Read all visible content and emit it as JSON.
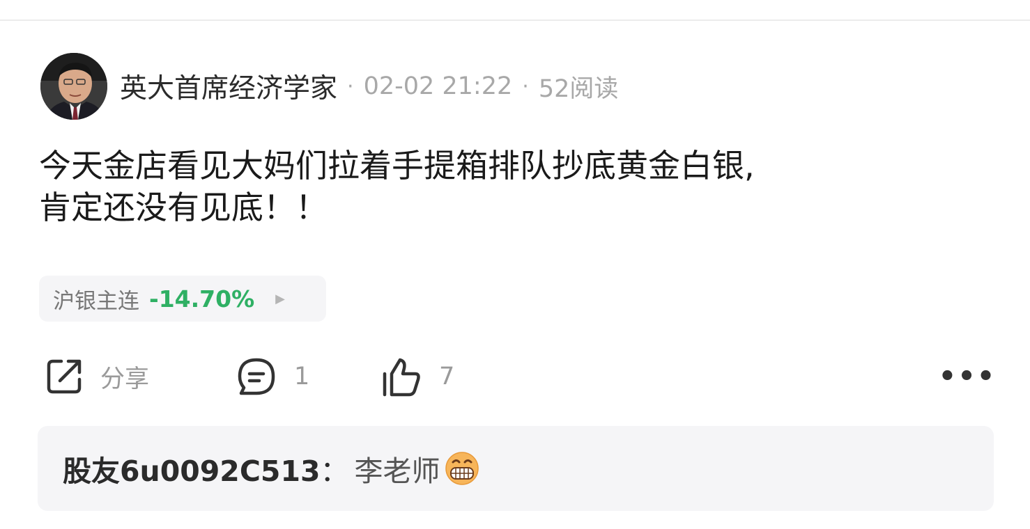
{
  "post": {
    "author": "英大首席经济学家",
    "separator": "·",
    "date": "02-02 21:22",
    "reads": "52阅读",
    "lines": [
      "今天金店看见大妈们拉着手提箱排队抄底黄金白银,",
      "肯定还没有见底！！"
    ]
  },
  "stock_tag": {
    "name": "沪银主连",
    "change": "-14.70%",
    "arrow": "▶",
    "change_color": "#2fb064"
  },
  "actions": {
    "share_label": "分享",
    "comment_count": "1",
    "like_count": "7",
    "more_label": "•••"
  },
  "reply": {
    "user": "股友6u0092C513",
    "colon": "：",
    "text": "李老师",
    "emoji": "grimacing-emoji"
  },
  "icons": {
    "share": "share-icon",
    "comment": "comment-icon",
    "like": "thumbs-up-icon"
  }
}
